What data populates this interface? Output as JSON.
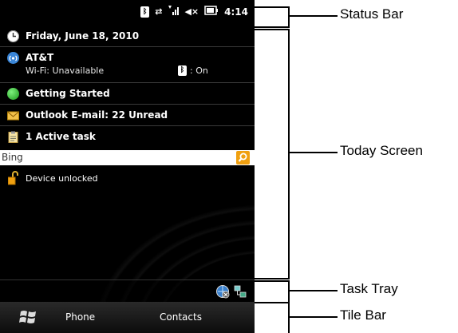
{
  "status_bar": {
    "time": "4:14",
    "icons": [
      "bluetooth-icon",
      "data-sync-icon",
      "signal-icon",
      "volume-icon",
      "battery-icon"
    ]
  },
  "today": {
    "date": "Friday, June 18, 2010",
    "carrier": "AT&T",
    "wifi": "Wi-Fi: Unavailable",
    "bluetooth_state": ": On",
    "getting_started": "Getting Started",
    "outlook": "Outlook E-mail: 22 Unread",
    "tasks": "1 Active task",
    "search_placeholder": "Bing",
    "device_lock": "Device unlocked"
  },
  "tile_bar": {
    "phone": "Phone",
    "contacts": "Contacts"
  },
  "callouts": {
    "status_bar": "Status Bar",
    "today_screen": "Today Screen",
    "task_tray": "Task Tray",
    "tile_bar": "Tile Bar"
  }
}
